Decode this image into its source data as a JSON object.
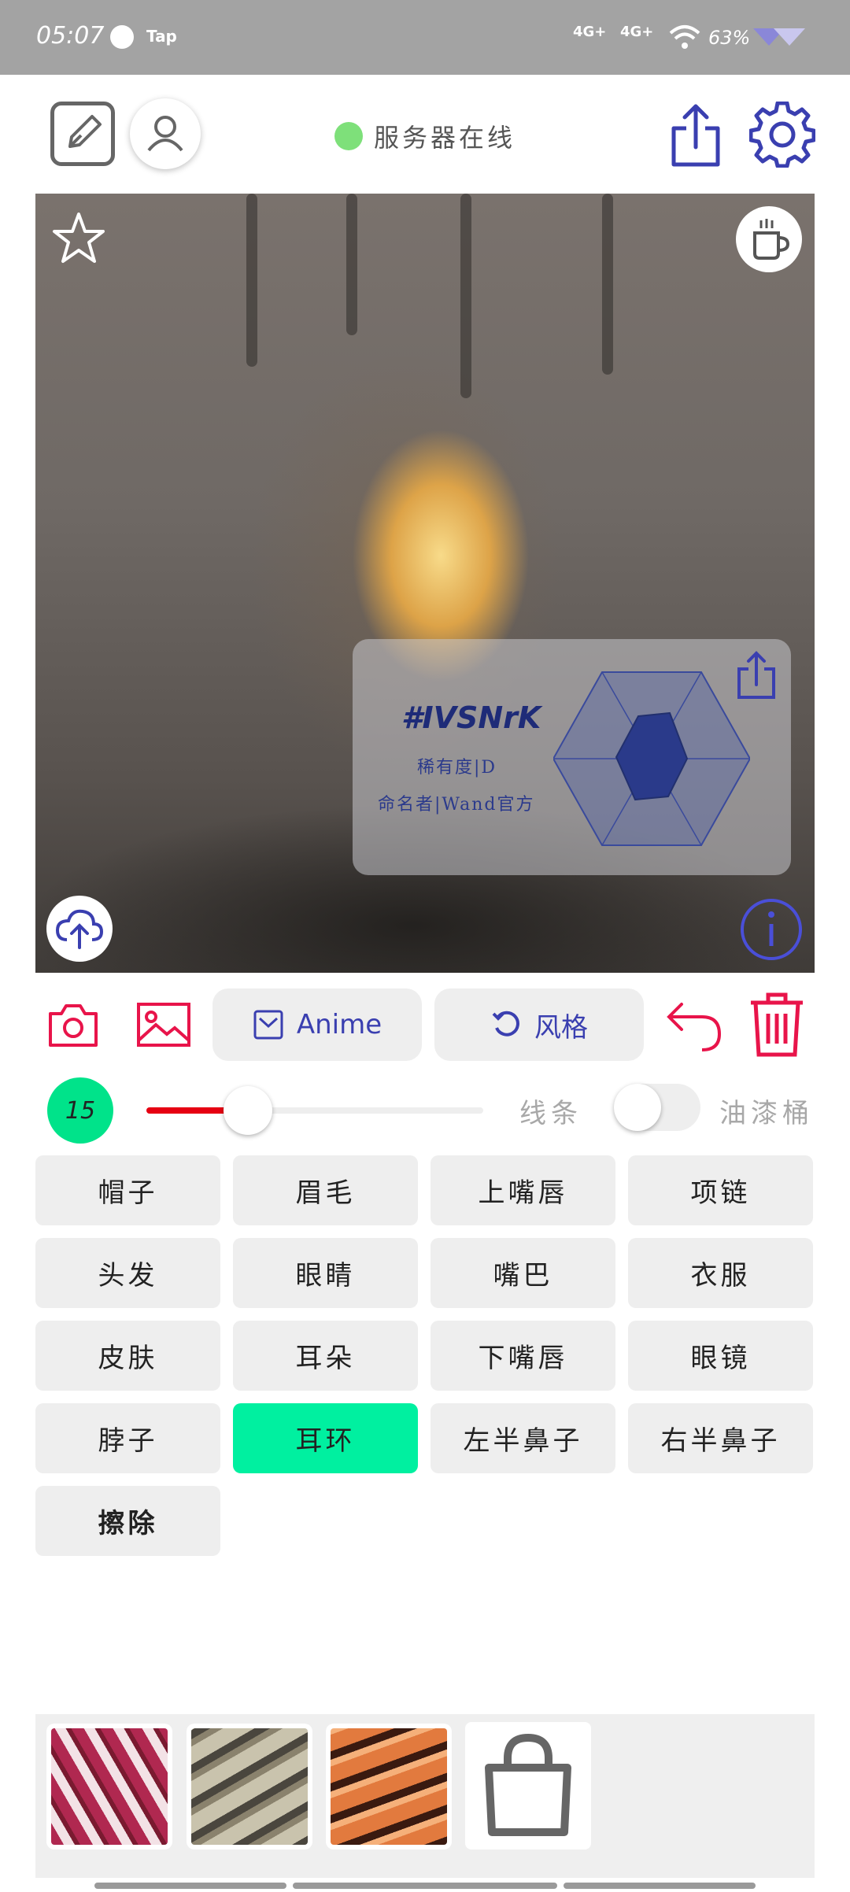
{
  "status_bar": {
    "time": "05:07",
    "app_badge": "Tap",
    "signal_1": "4G+",
    "signal_2": "4G+",
    "battery": "63%"
  },
  "header": {
    "server_status": "服务器在线",
    "status_color": "#7ee07a"
  },
  "canvas": {
    "card": {
      "code": "#IVSNrK",
      "rarity": "稀有度|D",
      "namer": "命名者|Wand官方"
    }
  },
  "toolbar": {
    "model_label": "Anime",
    "style_label": "风格"
  },
  "brush": {
    "size": "15",
    "level": 0.23,
    "mode_left": "线条",
    "mode_right": "油漆桶",
    "accent": "#e60012"
  },
  "parts": [
    {
      "label": "帽子"
    },
    {
      "label": "眉毛"
    },
    {
      "label": "上嘴唇"
    },
    {
      "label": "项链"
    },
    {
      "label": "头发"
    },
    {
      "label": "眼睛"
    },
    {
      "label": "嘴巴"
    },
    {
      "label": "衣服"
    },
    {
      "label": "皮肤"
    },
    {
      "label": "耳朵"
    },
    {
      "label": "下嘴唇"
    },
    {
      "label": "眼镜"
    },
    {
      "label": "脖子"
    },
    {
      "label": "耳环"
    },
    {
      "label": "左半鼻子"
    },
    {
      "label": "右半鼻子"
    },
    {
      "label": "擦除"
    }
  ],
  "active_part": "耳环",
  "colors": {
    "accent_green": "#00f0a0",
    "icon_pink": "#e8144a",
    "icon_blue": "#3a3fb0"
  }
}
